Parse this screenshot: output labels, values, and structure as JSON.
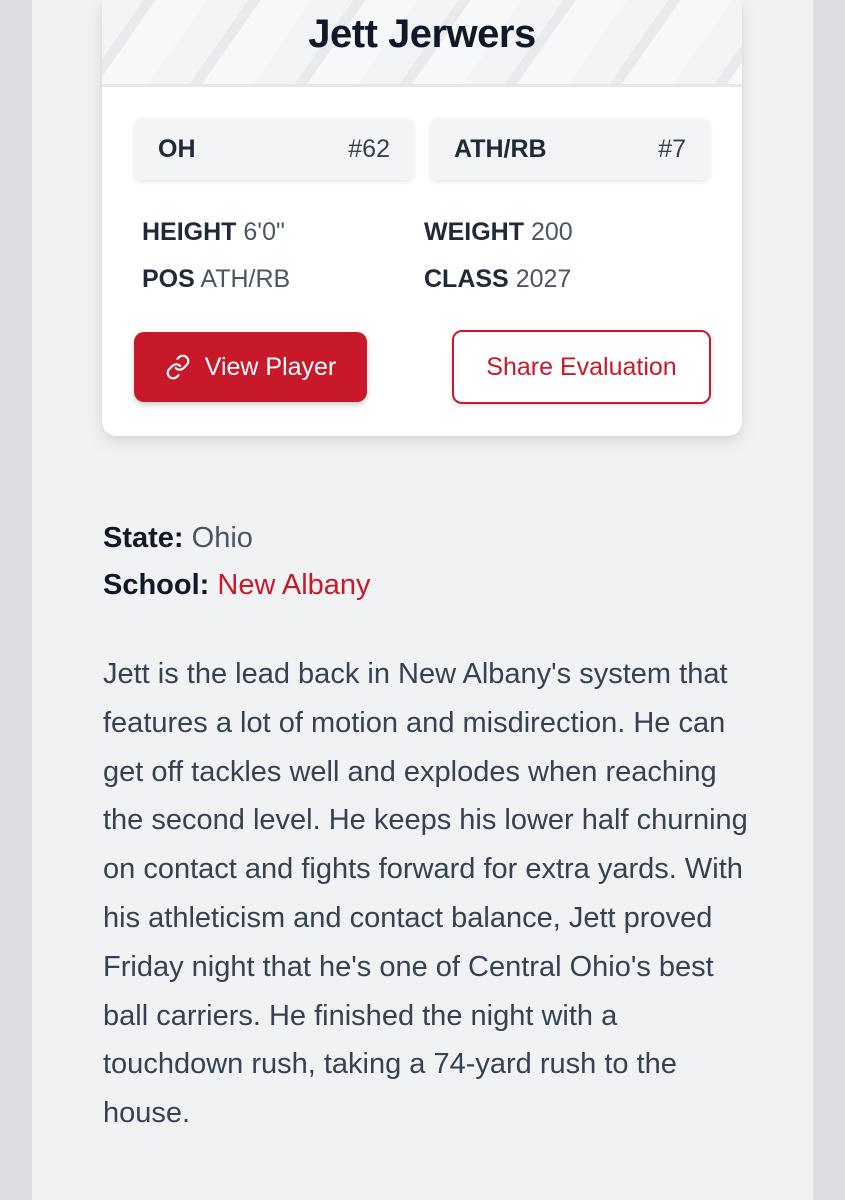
{
  "card": {
    "name": "Jett Jerwers",
    "positions": [
      {
        "code": "OH",
        "number": "#62"
      },
      {
        "code": "ATH/RB",
        "number": "#7"
      }
    ],
    "stats": {
      "height_label": "HEIGHT",
      "height_value": "6'0\"",
      "weight_label": "WEIGHT",
      "weight_value": "200",
      "pos_label": "POS",
      "pos_value": "ATH/RB",
      "class_label": "CLASS",
      "class_value": "2027"
    },
    "view_button": "View Player",
    "share_button": "Share Evaluation"
  },
  "info": {
    "state_label": "State:",
    "state_value": "Ohio",
    "school_label": "School:",
    "school_value": "New Albany"
  },
  "evaluation": "Jett is the lead back in New Albany's system that features a lot of motion and misdirection. He can get off tackles well and explodes when reaching the second level. He keeps his lower half churning on contact and fights forward for extra yards. With his athleticism and contact balance, Jett proved Friday night that he's one of Central Ohio's best ball carriers. He finished the night with a touchdown rush, taking a 74-yard rush to the house.",
  "colors": {
    "accent": "#c8192b",
    "text_dark": "#111827",
    "page_bg": "#f1f2f4"
  },
  "icons": {
    "view_button_icon": "link-icon"
  }
}
